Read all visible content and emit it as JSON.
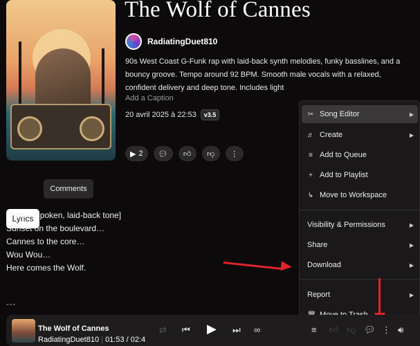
{
  "song": {
    "title": "The Wolf of Cannes",
    "artist": "RadiatingDuet810",
    "description": "90s West Coast G-Funk rap with laid-back synth melodies, funky basslines, and a bouncy groove. Tempo around 92 BPM. Smooth male vocals with a relaxed, confident delivery and deep tone. Includes light",
    "caption_placeholder": "Add a Caption",
    "date": "20 avril 2025 à 22:53",
    "version": "v3.5",
    "play_count": "2"
  },
  "tabs": {
    "lyrics": "Lyrics",
    "comments": "Comments"
  },
  "lyrics": [
    "[Intro – Spoken, laid-back tone]",
    "Sunset on the boulevard…",
    "Cannes to the core…",
    "Wou Wou…",
    "Here comes the Wolf."
  ],
  "separator": "---",
  "menu": {
    "song_editor": "Song Editor",
    "create": "Create",
    "add_to_queue": "Add to Queue",
    "add_to_playlist": "Add to Playlist",
    "move_to_workspace": "Move to Workspace",
    "visibility": "Visibility & Permissions",
    "share": "Share",
    "download": "Download",
    "report": "Report",
    "move_to_trash": "Move to Trash"
  },
  "player": {
    "title": "The Wolf of Cannes",
    "artist": "RadiatingDuet810",
    "time": "01:53 / 02:4"
  },
  "colors": {
    "accent_arrow": "#e0232a",
    "background": "#0c0a0b",
    "menu_bg": "#1a1819"
  },
  "icons": [
    "scissors-icon",
    "create-icon",
    "queue-icon",
    "plus-icon",
    "workspace-icon",
    "trash-icon",
    "play-icon",
    "comment-icon",
    "thumbs-up-icon",
    "thumbs-down-icon",
    "more-icon",
    "shuffle-icon",
    "prev-icon",
    "next-icon",
    "repeat-icon",
    "volume-icon"
  ]
}
